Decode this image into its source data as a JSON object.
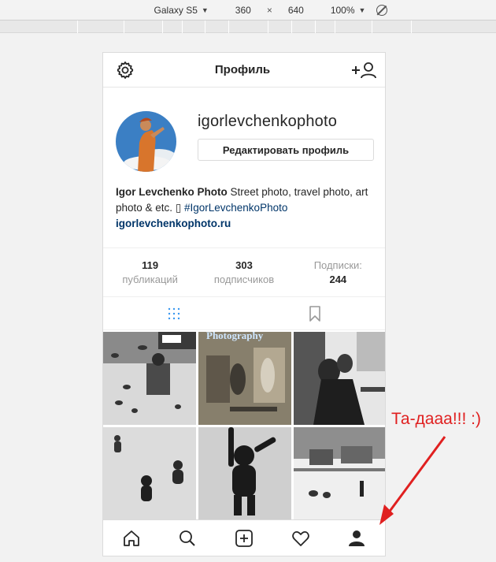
{
  "devtools": {
    "device": "Galaxy S5",
    "width": "360",
    "times": "×",
    "height": "640",
    "zoom": "100%"
  },
  "header": {
    "title": "Профиль",
    "left_icon": "gear-icon",
    "right_icon": "add-user-icon"
  },
  "profile": {
    "username": "igorlevchenkophoto",
    "edit_button": "Редактировать профиль",
    "bio_name": "Igor Levchenko Photo",
    "bio_text": " Street photo, travel photo, art photo & etc. ",
    "bio_box": "▯",
    "bio_hashtag": " #IgorLevchenkoPhoto",
    "bio_link": "igorlevchenkophoto.ru"
  },
  "stats": {
    "posts_count": "119",
    "posts_label": "публикаций",
    "followers_count": "303",
    "followers_label": "подписчиков",
    "following_label": "Подписки:",
    "following_count": "244"
  },
  "tabs": [
    "grid-icon",
    "bookmark-icon"
  ],
  "grid": [
    {
      "name": "photo-pigeons"
    },
    {
      "name": "photo-street-musicians",
      "caption": "Photography"
    },
    {
      "name": "photo-couple-tram"
    },
    {
      "name": "photo-snow-children"
    },
    {
      "name": "photo-child-statue"
    },
    {
      "name": "photo-snow-village"
    }
  ],
  "bottom_nav": [
    "home-icon",
    "search-icon",
    "add-post-icon",
    "heart-icon",
    "profile-icon"
  ],
  "annotation": {
    "text": "Та-дааа!!! :)",
    "color": "#e02020"
  }
}
